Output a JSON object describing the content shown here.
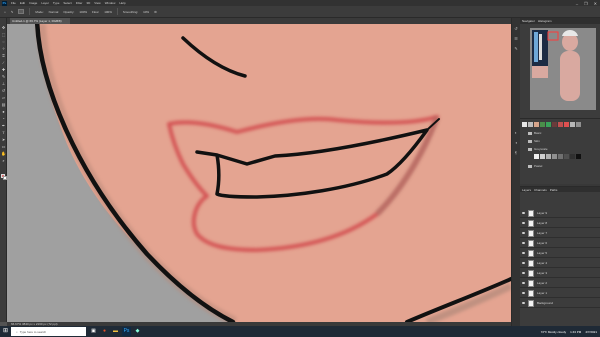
{
  "app": {
    "logo": "Ps",
    "menu": [
      "File",
      "Edit",
      "Image",
      "Layer",
      "Type",
      "Select",
      "Filter",
      "3D",
      "View",
      "Window",
      "Help"
    ],
    "window_controls": [
      "–",
      "❐",
      "✕"
    ]
  },
  "options_bar": {
    "items": [
      "Mode:",
      "Normal",
      "Opacity:",
      "100%",
      "Flow:",
      "100%",
      "Smoothing:",
      "10%"
    ]
  },
  "document": {
    "tab_title": "Untitled-1 @ 66.7% (Layer 1, RGB/8)"
  },
  "canvas": {
    "background_color": "#a0a0a0",
    "skin_color": "#e4a491",
    "lip_outline_color": "#d45454",
    "line_color": "#111111"
  },
  "toolbar": {
    "tools": [
      "move-icon",
      "marquee-icon",
      "lasso-icon",
      "magic-wand-icon",
      "crop-icon",
      "eyedropper-icon",
      "healing-icon",
      "brush-icon",
      "stamp-icon",
      "history-brush-icon",
      "eraser-icon",
      "gradient-icon",
      "blur-icon",
      "dodge-icon",
      "pen-icon",
      "type-icon",
      "path-select-icon",
      "rectangle-icon",
      "hand-icon",
      "zoom-icon"
    ],
    "foreground_color": "#e07070",
    "background_color": "#ffffff"
  },
  "right_panel": {
    "tabs": [
      "Navigator",
      "Histogram"
    ],
    "swatches": {
      "top_colors": [
        "#e8e8e8",
        "#bdbdbd",
        "#d6a48a",
        "#4a8f4a",
        "#3aa35a",
        "#6b3b3b",
        "#c05050",
        "#e05050",
        "#b8b8b8",
        "#909090"
      ],
      "groups": [
        "Basic",
        "Skin",
        "Greyscale",
        "Pastel"
      ],
      "grey_swatches": [
        "#f0f0f0",
        "#d0d0d0",
        "#b0b0b0",
        "#909090",
        "#707070",
        "#505050",
        "#303030",
        "#101010"
      ]
    },
    "layers_tabs": [
      "Layers",
      "Channels",
      "Paths"
    ],
    "layers": [
      "Layer 9",
      "Layer 8",
      "Layer 7",
      "Layer 6",
      "Layer 5",
      "Layer 4",
      "Layer 3",
      "Layer 2",
      "Layer 1",
      "Background"
    ]
  },
  "status_bar": {
    "text": "66.67%   3840 px x 2160 px (72 ppi)"
  },
  "taskbar": {
    "search_placeholder": "Type here to search",
    "tray_time": "1:43 PM",
    "tray_date": "4/7/2021",
    "tray_weather": "72°F  Mostly cloudy"
  }
}
